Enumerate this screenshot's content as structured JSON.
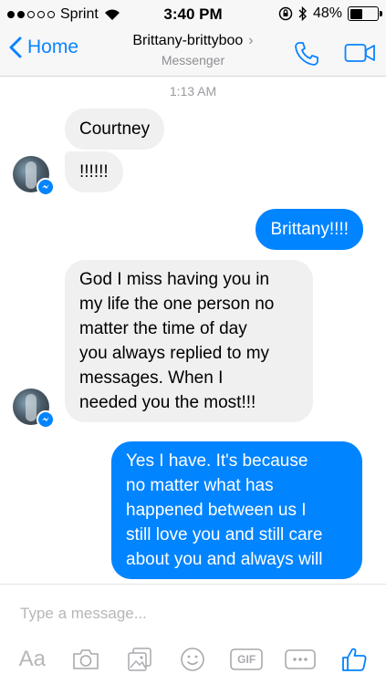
{
  "status_bar": {
    "carrier": "Sprint",
    "time": "3:40 PM",
    "battery_percent": "48%",
    "battery_level": 0.48
  },
  "header": {
    "back_label": "Home",
    "contact_name": "Brittany-brittyboo",
    "subtitle": "Messenger",
    "accent_color": "#0a84ff"
  },
  "chat": {
    "timestamp": "1:13 AM",
    "messages": [
      {
        "direction": "incoming",
        "text": "Courtney"
      },
      {
        "direction": "incoming",
        "text": "!!!!!!"
      },
      {
        "direction": "outgoing",
        "text": "Brittany!!!!"
      },
      {
        "direction": "incoming",
        "lines": [
          "God I miss having you in",
          "my life the one person no",
          "matter the time of day",
          "you always replied to my",
          "messages. When I",
          "needed you the most!!!"
        ]
      },
      {
        "direction": "outgoing",
        "lines": [
          "Yes I have. It's because",
          "no matter what has",
          "happened between us I",
          "still love you and still care",
          "about you and always will"
        ]
      }
    ],
    "outgoing_color": "#0084ff",
    "incoming_color": "#f0f0f0"
  },
  "composer": {
    "placeholder": "Type a message...",
    "tools": [
      "text-format-icon",
      "camera-icon",
      "photo-gallery-icon",
      "emoji-icon",
      "gif-icon",
      "more-icon",
      "like-icon"
    ],
    "aa_label": "Aa",
    "gif_label": "GIF"
  }
}
